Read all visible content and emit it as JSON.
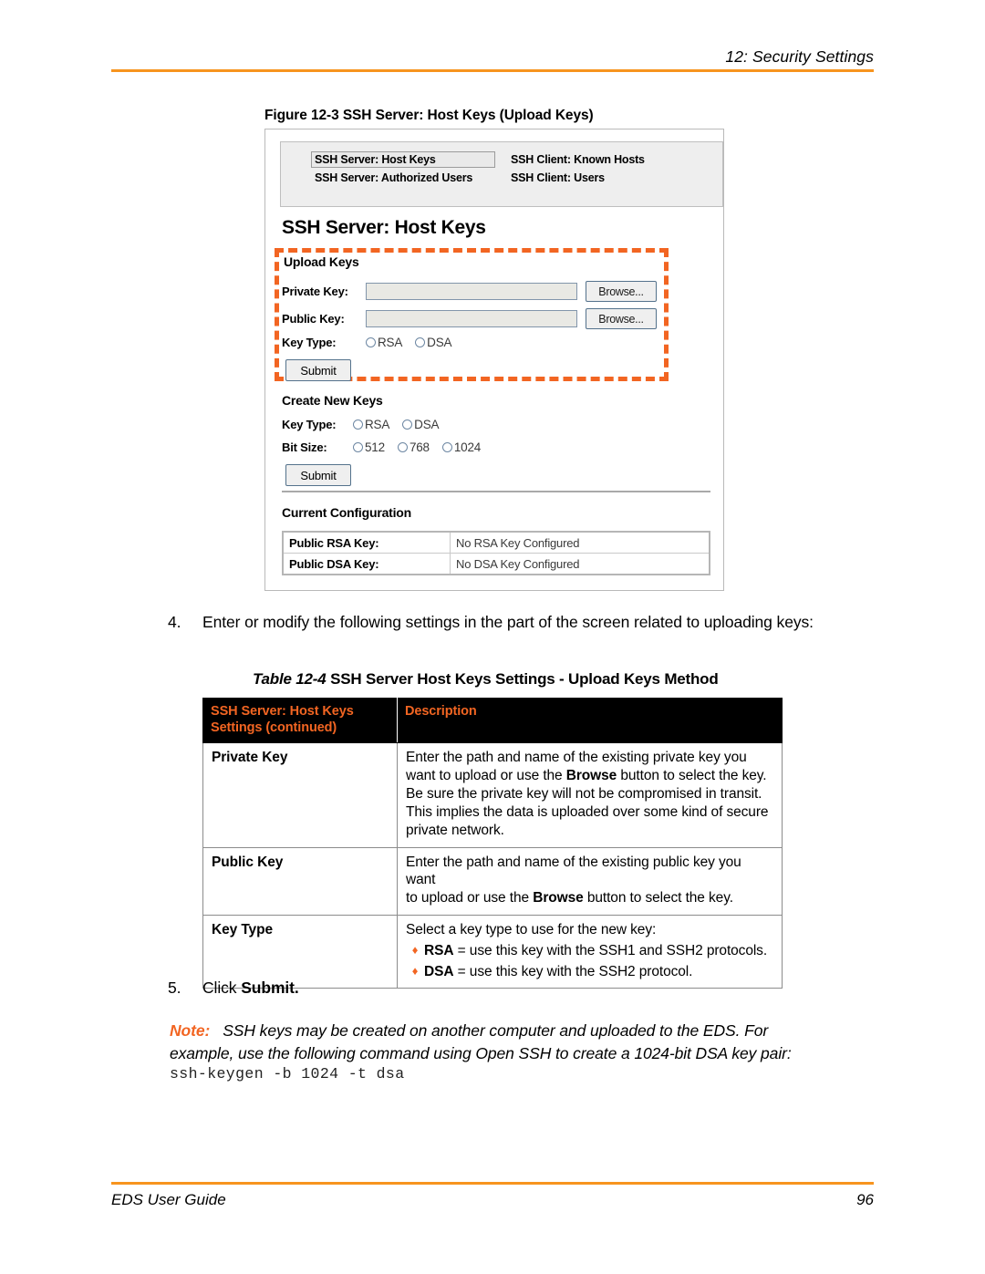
{
  "header": {
    "chapter_title": "12: Security Settings"
  },
  "footer": {
    "guide_title": "EDS User Guide",
    "page_number": "96"
  },
  "figure": {
    "caption_label": "Figure 12-3",
    "caption_text": "SSH Server: Host Keys (Upload Keys)",
    "screenshot": {
      "nav_links": [
        {
          "label": "SSH Server: Host Keys",
          "selected": true
        },
        {
          "label": "SSH Client: Known Hosts",
          "selected": false
        },
        {
          "label": "SSH Server: Authorized Users",
          "selected": false
        },
        {
          "label": "SSH Client: Users",
          "selected": false
        }
      ],
      "page_title": "SSH Server: Host Keys",
      "upload_keys": {
        "section_label": "Upload Keys",
        "private_key_label": "Private Key:",
        "private_key_value": "",
        "public_key_label": "Public Key:",
        "public_key_value": "",
        "browse_label": "Browse...",
        "key_type_label": "Key Type:",
        "key_type_options": [
          "RSA",
          "DSA"
        ],
        "submit_label": "Submit"
      },
      "create_new_keys": {
        "section_label": "Create New Keys",
        "key_type_label": "Key Type:",
        "key_type_options": [
          "RSA",
          "DSA"
        ],
        "bit_size_label": "Bit Size:",
        "bit_size_options": [
          "512",
          "768",
          "1024"
        ],
        "submit_label": "Submit"
      },
      "current_configuration": {
        "section_label": "Current Configuration",
        "rows": [
          {
            "key": "Public RSA Key:",
            "value": "No RSA Key Configured"
          },
          {
            "key": "Public DSA Key:",
            "value": "No DSA Key Configured"
          }
        ]
      }
    }
  },
  "steps": {
    "step4_num": "4.",
    "step4_text": "Enter or modify the following settings in the part of the screen related to uploading keys:",
    "step5_num": "5.",
    "step5_text_pre": "Click ",
    "step5_text_bold": "Submit."
  },
  "table": {
    "caption_label": "Table 12-4",
    "caption_text": "SSH Server Host Keys Settings - Upload Keys Method",
    "headers": {
      "col1_line1": "SSH Server: Host Keys",
      "col1_line2": "Settings (continued)",
      "col2": "Description"
    },
    "rows": [
      {
        "name": "Private Key",
        "lines": [
          "Enter the path and name of the existing private key you",
          "want to upload or use the Browse button to select the key.",
          "Be sure the private key will not be compromised in transit.",
          "This implies the data is uploaded over some kind of secure",
          "private network."
        ],
        "bullets": []
      },
      {
        "name": "Public Key",
        "lines": [
          "Enter the path and name of the existing public key you want",
          "to upload or use the Browse button to select the key."
        ],
        "bullets": []
      },
      {
        "name": "Key Type",
        "lines": [
          "Select a key type to use for the new key:"
        ],
        "bullets": [
          {
            "marker": "♦",
            "bold": "RSA",
            "rest": " = use this key with the SSH1 and SSH2 protocols."
          },
          {
            "marker": "♦",
            "bold": "DSA",
            "rest": " = use this key with the SSH2 protocol."
          }
        ]
      }
    ]
  },
  "note": {
    "label": "Note:",
    "line1": "SSH keys may be created on another computer and uploaded to the EDS. For",
    "line2": "example, use the following command using Open SSH to create a 1024-bit DSA key pair:",
    "command": "ssh-keygen -b 1024 -t dsa"
  },
  "colors": {
    "accent_orange": "#F26522",
    "rule_orange": "#F7941E",
    "header_black": "#000000"
  }
}
